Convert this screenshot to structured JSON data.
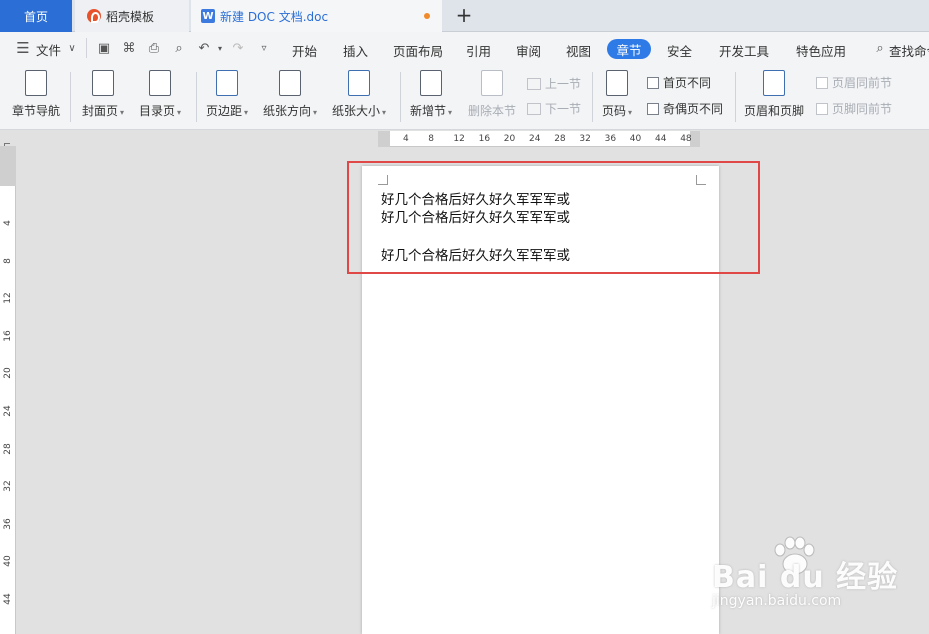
{
  "tabs": {
    "home": "首页",
    "template": "稻壳模板",
    "document": "新建 DOC 文档.doc",
    "new_tab": "+"
  },
  "menu": {
    "file": "文件",
    "items": [
      "开始",
      "插入",
      "页面布局",
      "引用",
      "审阅",
      "视图",
      "章节",
      "安全",
      "开发工具",
      "特色应用"
    ],
    "active": "章节",
    "search": "查找命令"
  },
  "ribbon": {
    "nav": "章节导航",
    "cover": "封面页",
    "toc": "目录页",
    "margins": "页边距",
    "orientation": "纸张方向",
    "size": "纸张大小",
    "new_section": "新增节",
    "delete_section": "删除本节",
    "prev_section": "上一节",
    "next_section": "下一节",
    "page_number": "页码",
    "first_page_diff": "首页不同",
    "odd_even_diff": "奇偶页不同",
    "header_footer": "页眉和页脚",
    "header_same_prev": "页眉同前节",
    "footer_same_prev": "页脚同前节"
  },
  "ruler": {
    "horizontal": [
      "4",
      "8",
      "12",
      "16",
      "20",
      "24",
      "28",
      "32",
      "36",
      "40",
      "44",
      "48"
    ],
    "vertical": [
      "4",
      "8",
      "12",
      "16",
      "20",
      "24",
      "28",
      "32",
      "36",
      "40",
      "44"
    ]
  },
  "document": {
    "lines": [
      "好几个合格后好久好久军军军或",
      "好几个合格后好久好久军军军或",
      "好几个合格后好久好久军军军或"
    ]
  },
  "watermark": {
    "brand": "Bai du 经验",
    "url": "jingyan.baidu.com"
  },
  "colors": {
    "accent": "#2e7ae6",
    "highlight_box": "#e04848"
  }
}
